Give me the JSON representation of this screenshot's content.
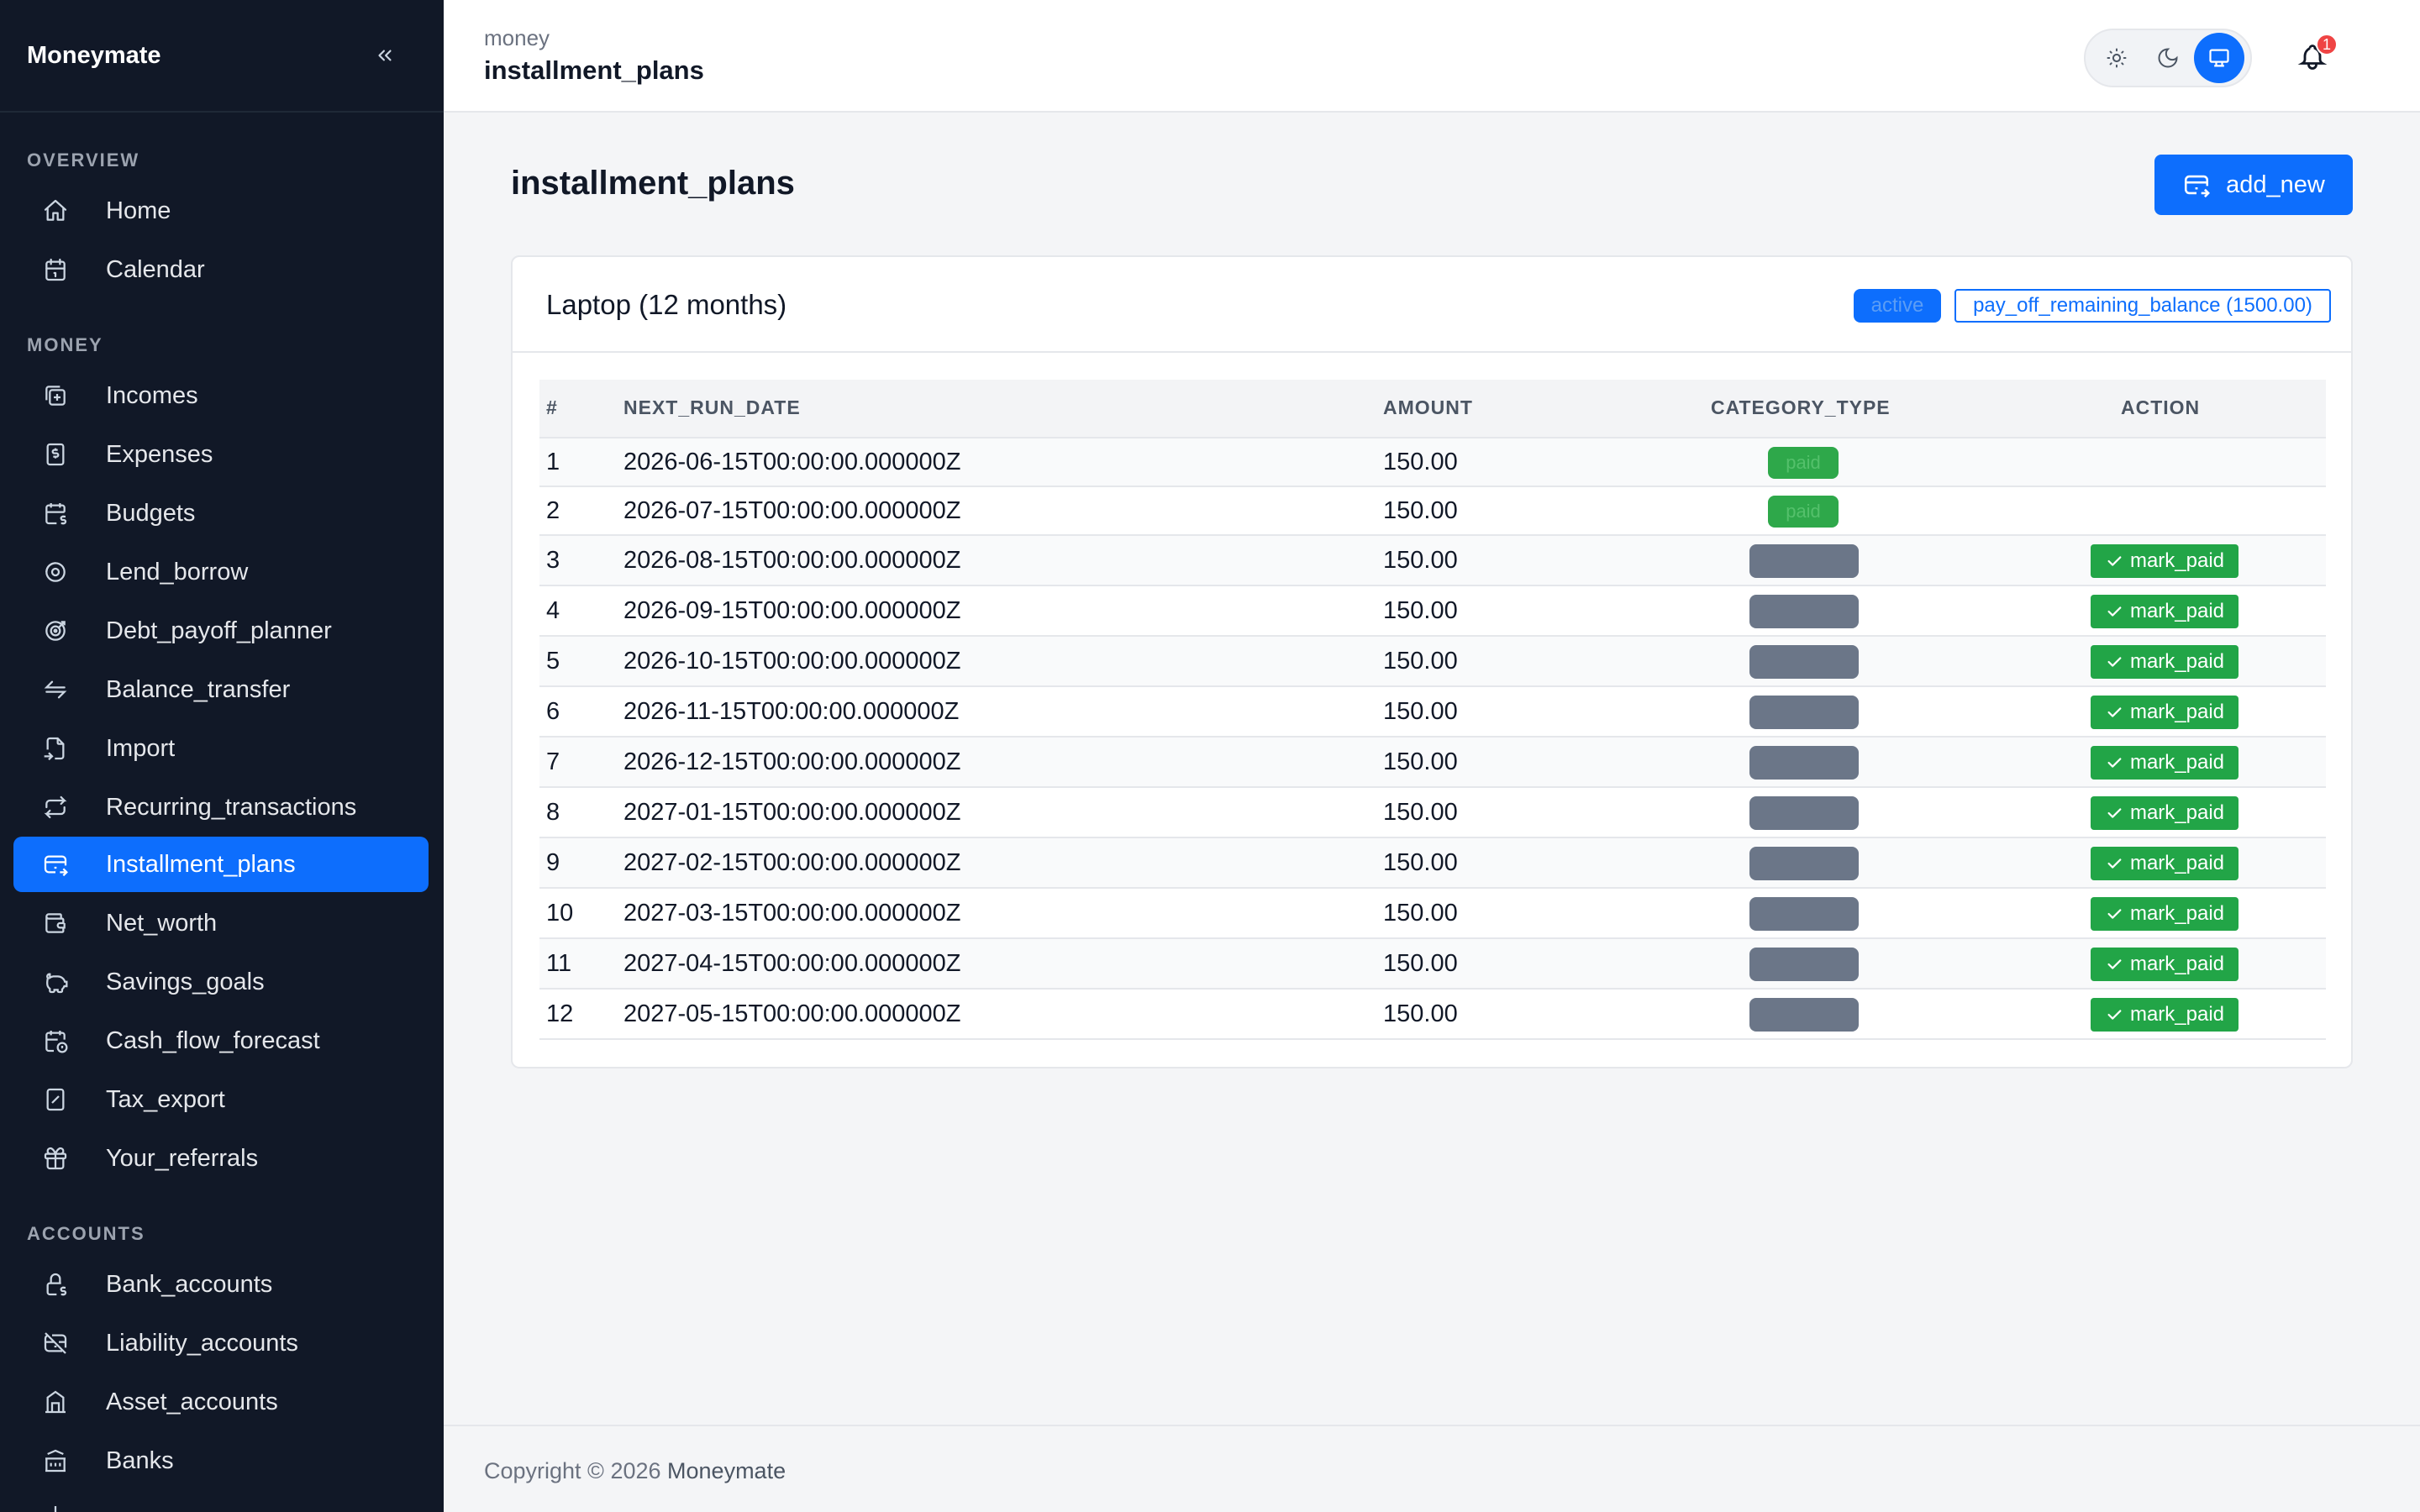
{
  "sidebar": {
    "brand": "Moneymate",
    "sections": {
      "overview": "OVERVIEW",
      "money": "MONEY",
      "accounts": "ACCOUNTS"
    },
    "overview_items": [
      {
        "label": "Home",
        "icon": "home-icon"
      },
      {
        "label": "Calendar",
        "icon": "calendar-icon"
      }
    ],
    "money_items": [
      {
        "label": "Incomes",
        "icon": "plus-square-icon"
      },
      {
        "label": "Expenses",
        "icon": "dollar-file-icon"
      },
      {
        "label": "Budgets",
        "icon": "calendar-dollar-icon"
      },
      {
        "label": "Lend_borrow",
        "icon": "cycle-icon"
      },
      {
        "label": "Debt_payoff_planner",
        "icon": "target-icon"
      },
      {
        "label": "Balance_transfer",
        "icon": "transfer-arrows-icon"
      },
      {
        "label": "Import",
        "icon": "file-import-icon"
      },
      {
        "label": "Recurring_transactions",
        "icon": "repeat-icon"
      },
      {
        "label": "Installment_plans",
        "icon": "credit-card-transfer-icon",
        "active": true
      },
      {
        "label": "Net_worth",
        "icon": "wallet-icon"
      },
      {
        "label": "Savings_goals",
        "icon": "piggy-bank-icon"
      },
      {
        "label": "Cash_flow_forecast",
        "icon": "calendar-clock-icon"
      },
      {
        "label": "Tax_export",
        "icon": "percent-receipt-icon"
      },
      {
        "label": "Your_referrals",
        "icon": "gift-icon"
      }
    ],
    "account_items": [
      {
        "label": "Bank_accounts",
        "icon": "lock-dollar-icon"
      },
      {
        "label": "Liability_accounts",
        "icon": "credit-card-off-icon"
      },
      {
        "label": "Asset_accounts",
        "icon": "building-icon"
      },
      {
        "label": "Banks",
        "icon": "bank-icon"
      }
    ]
  },
  "topbar": {
    "crumb_parent": "money",
    "crumb_current": "installment_plans",
    "notification_count": "1"
  },
  "main": {
    "title": "installment_plans",
    "add_button": "add_new",
    "card": {
      "title": "Laptop (12 months)",
      "status_badge": "active",
      "payoff_badge": "pay_off_remaining_balance (1500.00)",
      "columns": [
        "#",
        "NEXT_RUN_DATE",
        "AMOUNT",
        "CATEGORY_TYPE",
        "ACTION"
      ],
      "rows": [
        {
          "n": "1",
          "date": "2026-06-15T00:00:00.000000Z",
          "amount": "150.00",
          "status": "paid",
          "action": ""
        },
        {
          "n": "2",
          "date": "2026-07-15T00:00:00.000000Z",
          "amount": "150.00",
          "status": "paid",
          "action": ""
        },
        {
          "n": "3",
          "date": "2026-08-15T00:00:00.000000Z",
          "amount": "150.00",
          "status": "",
          "action": "mark_paid"
        },
        {
          "n": "4",
          "date": "2026-09-15T00:00:00.000000Z",
          "amount": "150.00",
          "status": "",
          "action": "mark_paid"
        },
        {
          "n": "5",
          "date": "2026-10-15T00:00:00.000000Z",
          "amount": "150.00",
          "status": "",
          "action": "mark_paid"
        },
        {
          "n": "6",
          "date": "2026-11-15T00:00:00.000000Z",
          "amount": "150.00",
          "status": "",
          "action": "mark_paid"
        },
        {
          "n": "7",
          "date": "2026-12-15T00:00:00.000000Z",
          "amount": "150.00",
          "status": "",
          "action": "mark_paid"
        },
        {
          "n": "8",
          "date": "2027-01-15T00:00:00.000000Z",
          "amount": "150.00",
          "status": "",
          "action": "mark_paid"
        },
        {
          "n": "9",
          "date": "2027-02-15T00:00:00.000000Z",
          "amount": "150.00",
          "status": "",
          "action": "mark_paid"
        },
        {
          "n": "10",
          "date": "2027-03-15T00:00:00.000000Z",
          "amount": "150.00",
          "status": "",
          "action": "mark_paid"
        },
        {
          "n": "11",
          "date": "2027-04-15T00:00:00.000000Z",
          "amount": "150.00",
          "status": "",
          "action": "mark_paid"
        },
        {
          "n": "12",
          "date": "2027-05-15T00:00:00.000000Z",
          "amount": "150.00",
          "status": "",
          "action": "mark_paid"
        }
      ]
    }
  },
  "footer": {
    "copyright": "Copyright © 2026",
    "brand_link": "Moneymate"
  },
  "colors": {
    "accent": "#0d6efd",
    "sidebar_bg": "#111827",
    "success": "#22a547",
    "pending": "#6b7688"
  }
}
